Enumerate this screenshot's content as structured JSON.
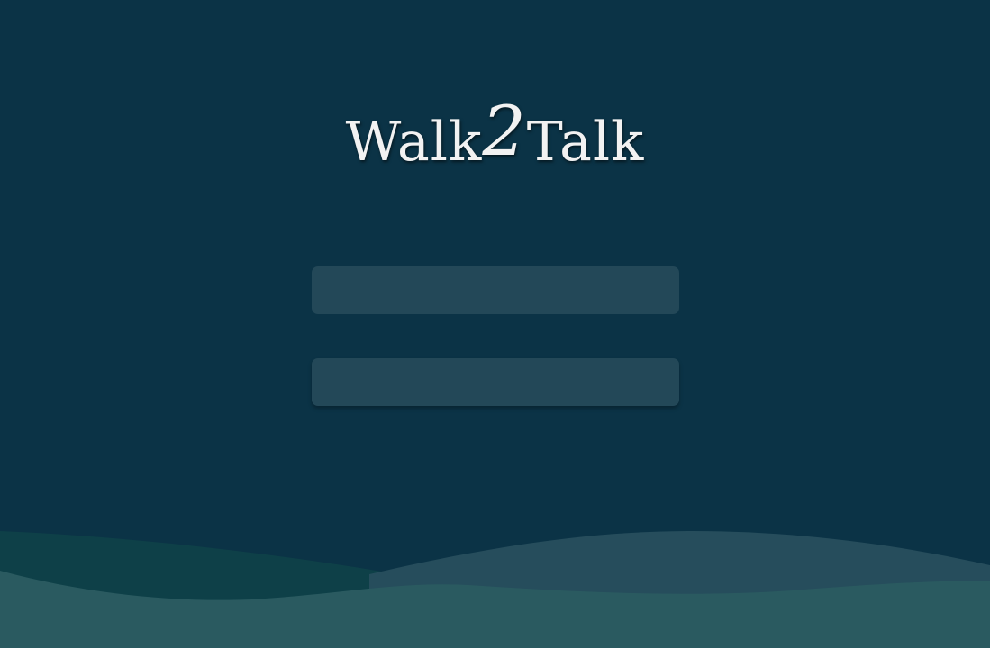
{
  "app": {
    "logo_left": "Walk",
    "logo_number": "2",
    "logo_right": "Talk"
  },
  "login_form": {
    "username_value": "",
    "password_value": ""
  },
  "colors": {
    "background": "#0b3346",
    "field_background": "#234858",
    "wave_back_left": "#0e4048",
    "wave_back_right": "#264d5c",
    "wave_front": "#2a5a60"
  }
}
